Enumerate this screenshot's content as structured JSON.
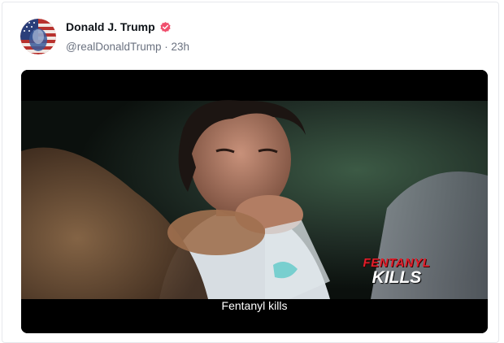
{
  "post": {
    "author_name": "Donald J. Trump",
    "handle": "@realDonaldTrump",
    "separator": " · ",
    "time": "23h"
  },
  "video": {
    "overlay_line1": "FENTANYL",
    "overlay_line2": "KILLS",
    "caption": "Fentanyl kills"
  },
  "colors": {
    "verified_badge": "#f0506e",
    "overlay_red": "#e11d2a",
    "caption_text": "#ffffff"
  }
}
